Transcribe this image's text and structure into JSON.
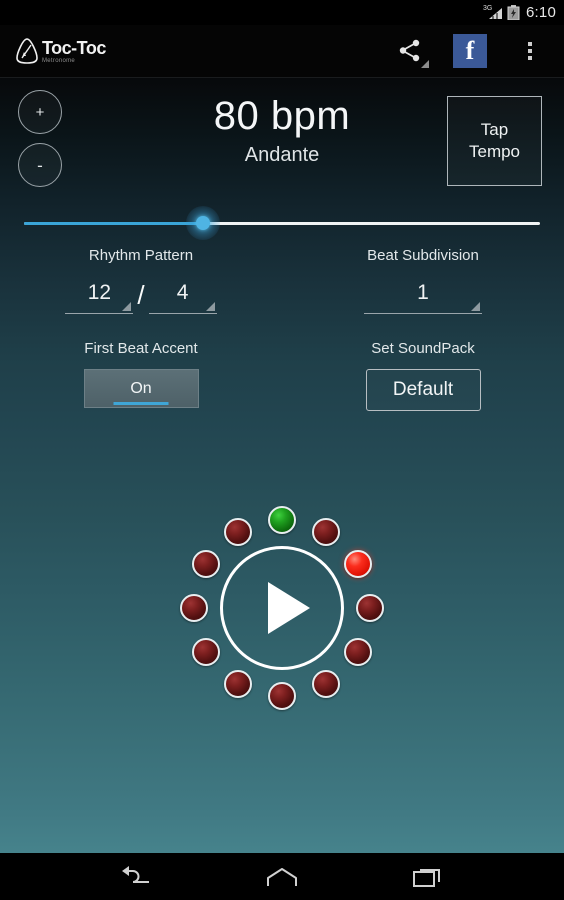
{
  "status_bar": {
    "network_label": "3G",
    "time": "6:10",
    "icons": [
      "signal-icon",
      "battery-icon"
    ]
  },
  "action_bar": {
    "logo_title": "Toc-Toc",
    "logo_subtitle": "Metronome",
    "actions": [
      {
        "name": "share-icon",
        "label": "Share"
      },
      {
        "name": "facebook-icon",
        "label": "f"
      },
      {
        "name": "overflow-menu-icon",
        "label": "More options"
      }
    ]
  },
  "tempo": {
    "increase_label": "+",
    "decrease_label": "-",
    "bpm": "80 bpm",
    "bpm_value": 80,
    "tempo_name": "Andante",
    "tap_tempo_label": "Tap\nTempo",
    "tap_tempo_line1": "Tap",
    "tap_tempo_line2": "Tempo"
  },
  "slider": {
    "value_percent": 36,
    "fill_color": "#3aa5d8",
    "track_color": "#f0f4f5",
    "thumb_color": "#4fb4e3"
  },
  "settings": {
    "rhythm_pattern": {
      "label": "Rhythm Pattern",
      "numerator": "12",
      "separator": "/",
      "denominator": "4"
    },
    "beat_subdivision": {
      "label": "Beat Subdivision",
      "value": "1"
    },
    "first_beat_accent": {
      "label": "First Beat Accent",
      "state": "On",
      "accent_color": "#3fa6d6"
    },
    "sound_pack": {
      "label": "Set SoundPack",
      "value": "Default"
    }
  },
  "beat_circle": {
    "total_beats": 12,
    "accent_beat_index": 1,
    "active_beat_index": 3,
    "transport_state": "play",
    "play_icon": "play-icon",
    "colors": {
      "accent": "#1fa01f",
      "active": "#fb2d1d",
      "idle": "#7d1f1f"
    }
  },
  "nav_bar": {
    "buttons": [
      {
        "name": "back-button",
        "label": "Back"
      },
      {
        "name": "home-button",
        "label": "Home"
      },
      {
        "name": "recents-button",
        "label": "Recents"
      }
    ]
  }
}
